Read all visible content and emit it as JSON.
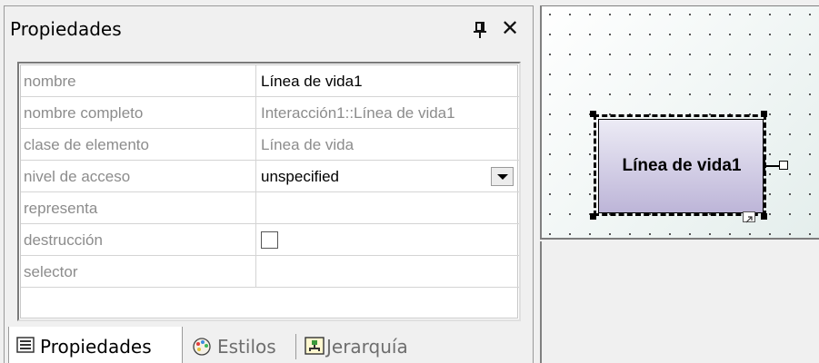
{
  "panel": {
    "title": "Propiedades"
  },
  "properties": [
    {
      "key": "nombre",
      "value": "Línea de vida1",
      "value_style": "black"
    },
    {
      "key": "nombre completo",
      "value": "Interacción1::Línea de vida1",
      "value_style": "gray"
    },
    {
      "key": "clase de elemento",
      "value": "Línea de vida",
      "value_style": "gray"
    },
    {
      "key": "nivel de acceso",
      "value": "unspecified",
      "value_style": "black"
    },
    {
      "key": "representa",
      "value": ""
    },
    {
      "key": "destrucción",
      "value": ""
    },
    {
      "key": "selector",
      "value": ""
    }
  ],
  "tabs": [
    {
      "label": "Propiedades",
      "icon": "list-icon",
      "active": true
    },
    {
      "label": "Estilos",
      "icon": "palette-icon",
      "active": false
    },
    {
      "label": "Jerarquía",
      "icon": "hierarchy-icon",
      "active": false
    }
  ],
  "diagram": {
    "lifeline_label": "Línea de vida1"
  },
  "colors": {
    "lifeline_top": "#ecebf5",
    "lifeline_bottom": "#bdb5d8",
    "key_text": "#8c8c8c"
  }
}
